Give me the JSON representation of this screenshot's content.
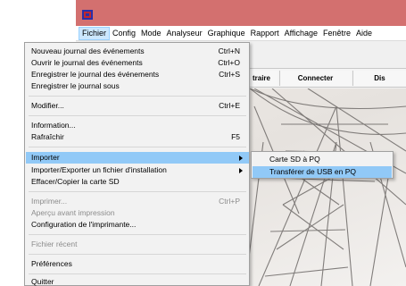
{
  "menubar": {
    "items": [
      "Fichier",
      "Config",
      "Mode",
      "Analyseur",
      "Graphique",
      "Rapport",
      "Affichage",
      "Fenêtre",
      "Aide"
    ]
  },
  "toolbar": {
    "buttons": [
      "traire",
      "Connecter",
      "Dis"
    ]
  },
  "file_menu": {
    "items": [
      {
        "label": "Nouveau journal des événements",
        "shortcut": "Ctrl+N"
      },
      {
        "label": "Ouvrir le journal des événements",
        "shortcut": "Ctrl+O"
      },
      {
        "label": "Enregistrer le journal des événements",
        "shortcut": "Ctrl+S"
      },
      {
        "label": "Enregistrer le journal sous",
        "shortcut": ""
      },
      {
        "label": "Modifier...",
        "shortcut": "Ctrl+E"
      },
      {
        "label": "Information...",
        "shortcut": ""
      },
      {
        "label": "Rafraîchir",
        "shortcut": "F5"
      },
      {
        "label": "Importer",
        "shortcut": ""
      },
      {
        "label": "Importer/Exporter un fichier d'installation",
        "shortcut": ""
      },
      {
        "label": "Effacer/Copier la carte SD",
        "shortcut": ""
      },
      {
        "label": "Imprimer...",
        "shortcut": "Ctrl+P"
      },
      {
        "label": "Aperçu avant impression",
        "shortcut": ""
      },
      {
        "label": "Configuration de l'imprimante...",
        "shortcut": ""
      },
      {
        "label": "Fichier récent",
        "shortcut": ""
      },
      {
        "label": "Préférences",
        "shortcut": ""
      },
      {
        "label": "Quitter",
        "shortcut": ""
      }
    ]
  },
  "import_submenu": {
    "items": [
      "Carte SD à PQ",
      "Transférer de USB en PQ"
    ]
  },
  "colors": {
    "titlebar": "#d3706f",
    "highlight": "#91c9f7",
    "menubar_active": "#cce8ff"
  }
}
